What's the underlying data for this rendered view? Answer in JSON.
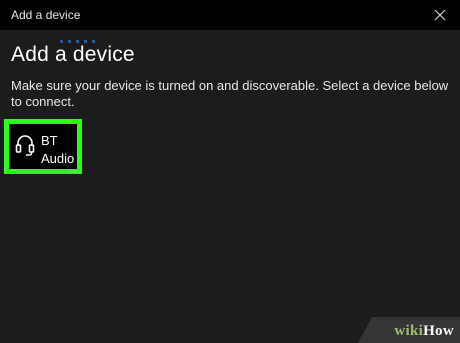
{
  "window": {
    "title": "Add a device"
  },
  "titlebar": {
    "close_icon": "close-icon"
  },
  "main": {
    "heading": "Add a device",
    "instructions": "Make sure your device is turned on and discoverable. Select a device below to connect."
  },
  "devices": [
    {
      "name": "BT\nAudio",
      "icon": "headphones-icon",
      "highlight_color": "#2bff1b"
    }
  ],
  "watermark": {
    "wiki": "wiki",
    "how": "How"
  },
  "colors": {
    "titlebar_bg": "#000000",
    "window_bg": "#1c1c1c",
    "text": "#ffffff",
    "highlight": "#2bff1b",
    "accent": "#2d7fd8"
  }
}
